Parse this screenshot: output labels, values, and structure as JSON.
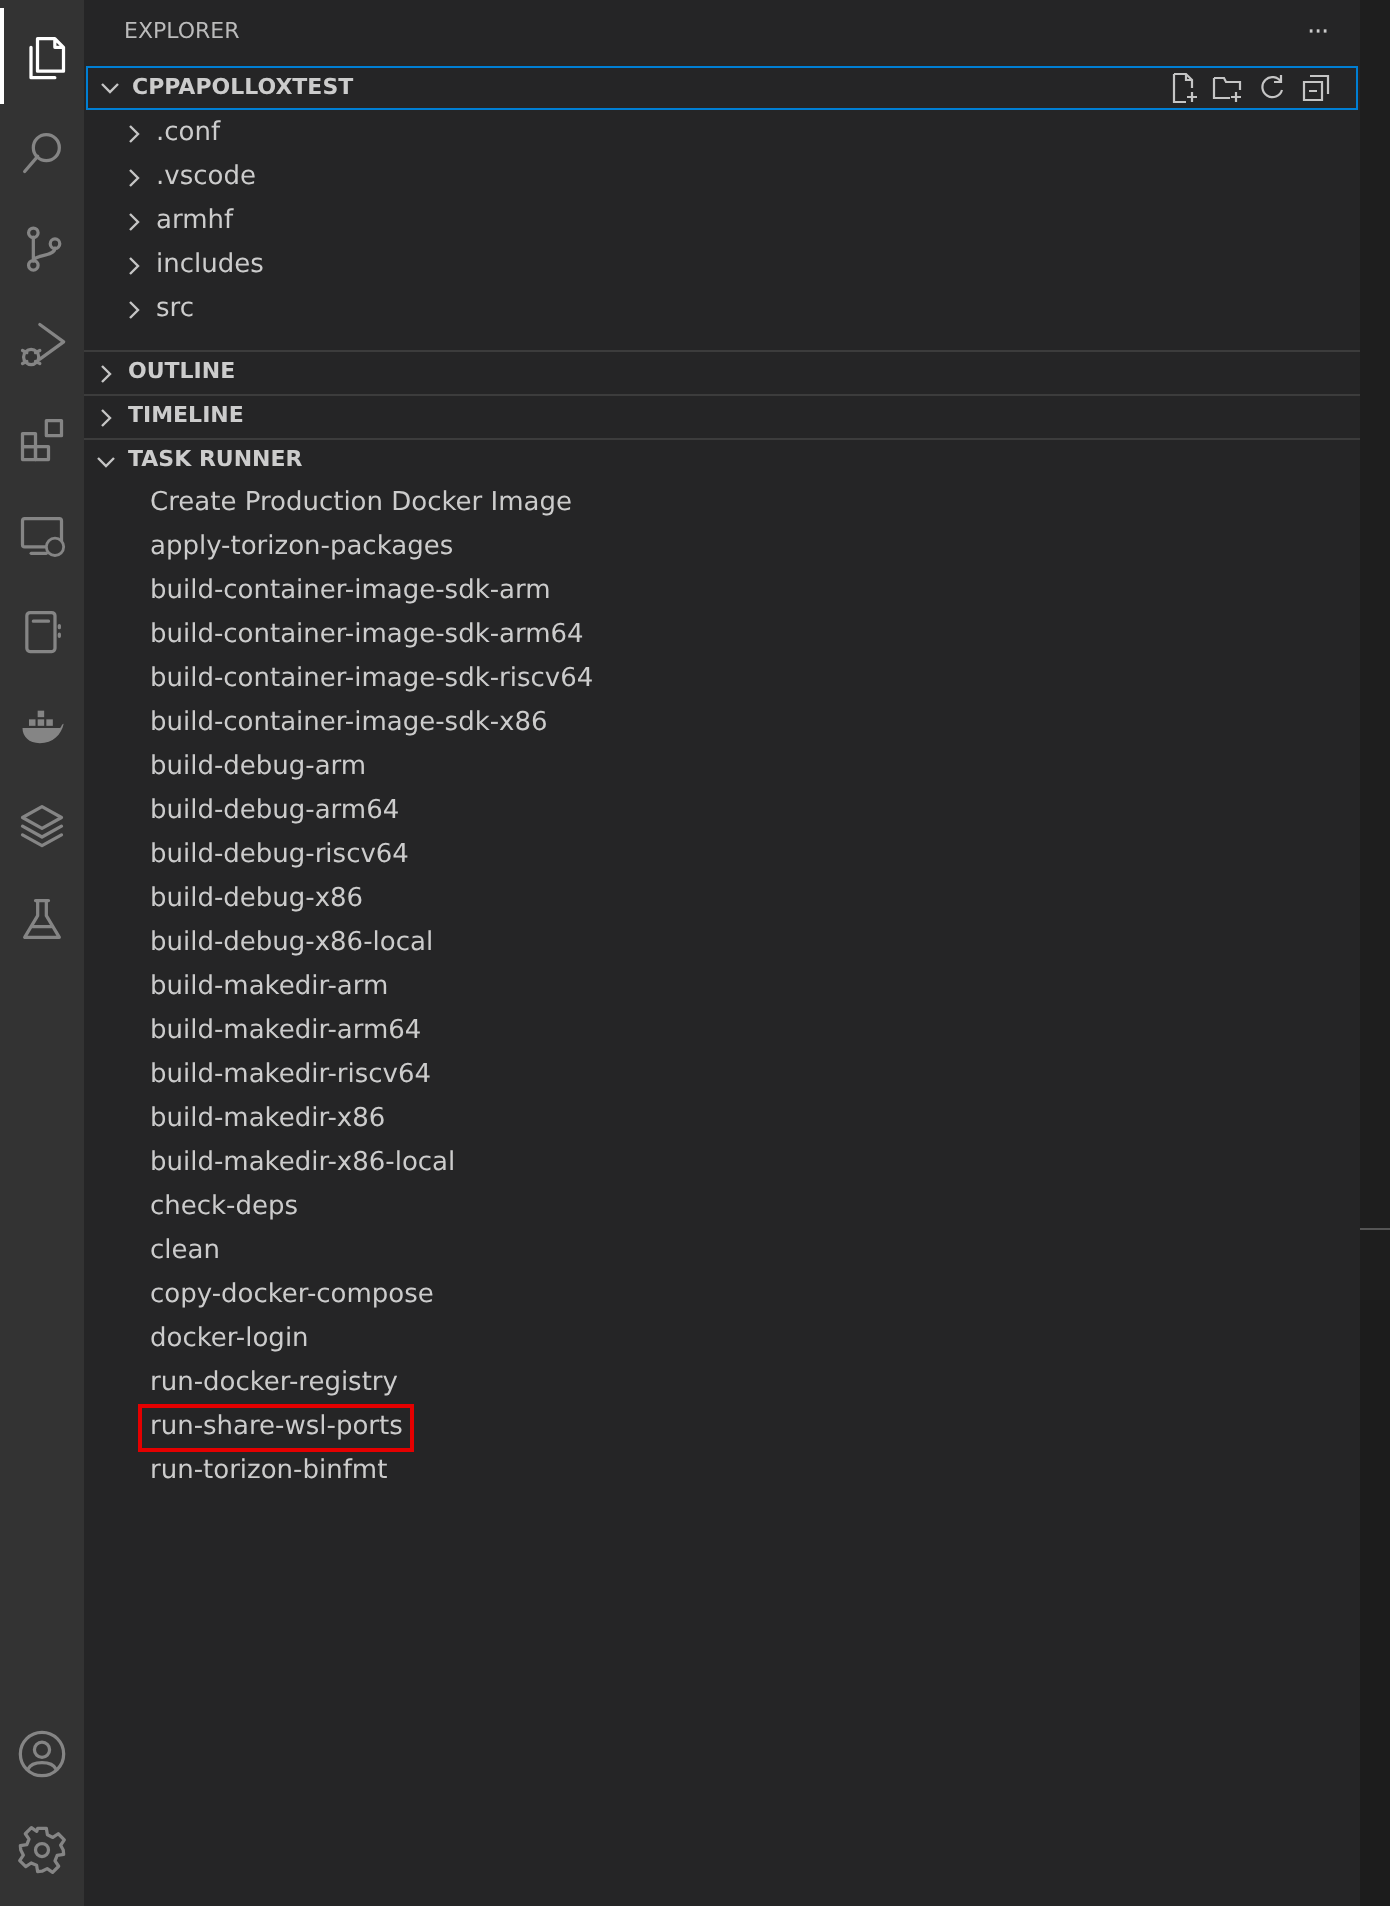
{
  "activity_bar": {
    "top": [
      {
        "kind": "files",
        "selected": true
      },
      {
        "kind": "search",
        "selected": false
      },
      {
        "kind": "source-control",
        "selected": false
      },
      {
        "kind": "run-debug",
        "selected": false
      },
      {
        "kind": "extensions",
        "selected": false
      },
      {
        "kind": "remote",
        "selected": false
      },
      {
        "kind": "notebook",
        "selected": false
      },
      {
        "kind": "docker",
        "selected": false
      },
      {
        "kind": "layers",
        "selected": false
      },
      {
        "kind": "testing",
        "selected": false
      }
    ],
    "bottom": [
      {
        "kind": "account"
      },
      {
        "kind": "settings"
      }
    ]
  },
  "sidebar": {
    "title": "EXPLORER",
    "more": "···",
    "sections": [
      {
        "kind": "folder",
        "title": "CPPAPOLLOXTEST",
        "expanded": true,
        "focused": true,
        "items": [
          {
            "label": ".conf",
            "expanded": false
          },
          {
            "label": ".vscode",
            "expanded": false
          },
          {
            "label": "armhf",
            "expanded": false
          },
          {
            "label": "includes",
            "expanded": false
          },
          {
            "label": "src",
            "expanded": false
          }
        ]
      },
      {
        "title": "OUTLINE",
        "expanded": false,
        "focused": false
      },
      {
        "title": "TIMELINE",
        "expanded": false,
        "focused": false
      },
      {
        "kind": "tasks",
        "title": "TASK RUNNER",
        "expanded": true,
        "focused": false,
        "items": [
          {
            "label": "Create Production Docker Image",
            "highlighted": false
          },
          {
            "label": "apply-torizon-packages",
            "highlighted": false
          },
          {
            "label": "build-container-image-sdk-arm",
            "highlighted": false
          },
          {
            "label": "build-container-image-sdk-arm64",
            "highlighted": false
          },
          {
            "label": "build-container-image-sdk-riscv64",
            "highlighted": false
          },
          {
            "label": "build-container-image-sdk-x86",
            "highlighted": false
          },
          {
            "label": "build-debug-arm",
            "highlighted": false
          },
          {
            "label": "build-debug-arm64",
            "highlighted": false
          },
          {
            "label": "build-debug-riscv64",
            "highlighted": false
          },
          {
            "label": "build-debug-x86",
            "highlighted": false
          },
          {
            "label": "build-debug-x86-local",
            "highlighted": false
          },
          {
            "label": "build-makedir-arm",
            "highlighted": false
          },
          {
            "label": "build-makedir-arm64",
            "highlighted": false
          },
          {
            "label": "build-makedir-riscv64",
            "highlighted": false
          },
          {
            "label": "build-makedir-x86",
            "highlighted": false
          },
          {
            "label": "build-makedir-x86-local",
            "highlighted": false
          },
          {
            "label": "check-deps",
            "highlighted": false
          },
          {
            "label": "clean",
            "highlighted": false
          },
          {
            "label": "copy-docker-compose",
            "highlighted": false
          },
          {
            "label": "docker-login",
            "highlighted": false
          },
          {
            "label": "run-docker-registry",
            "highlighted": false
          },
          {
            "label": "run-share-wsl-ports",
            "highlighted": true
          },
          {
            "label": "run-torizon-binfmt",
            "highlighted": false
          }
        ]
      }
    ]
  }
}
